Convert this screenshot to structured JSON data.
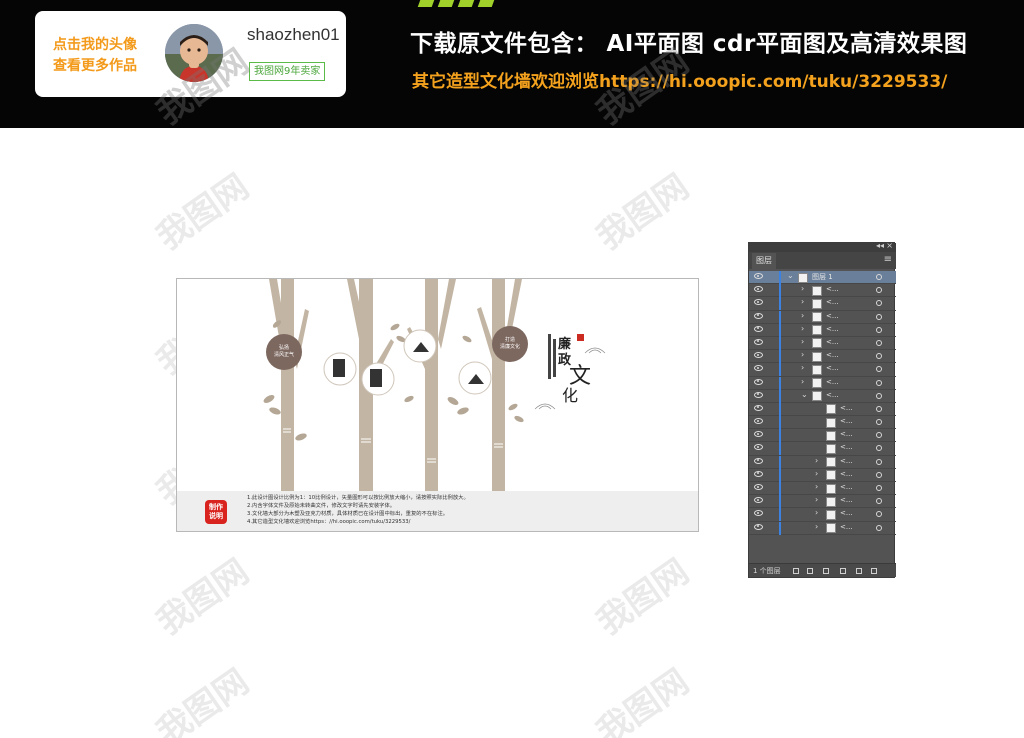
{
  "banner": {
    "profile": {
      "cta_line1": "点击我的头像",
      "cta_line2": "查看更多作品",
      "username": "shaozhen01",
      "badge": "我图网9年卖家"
    },
    "headline": "下载原文件包含：  AI平面图  cdr平面图及高清效果图",
    "subline": "其它造型文化墙欢迎浏览https://hi.ooopic.com/tuku/3229533/"
  },
  "watermark_text": "我图网",
  "artwork": {
    "title_chars": [
      "廉",
      "政",
      "文",
      "化"
    ],
    "circle_left_text": "弘扬\n清风正气",
    "circle_right_text": "打造\n清廉文化",
    "notes_badge": "制作\n说明",
    "notes": [
      "1.此设计图设计比例为1：10比例设计，矢量图形可以按比例放大缩小，请按照实际比例放大。",
      "2.内含字体文件及原始未转曲文件，修改文字时请先安装字体。",
      "3.文化墙大部分为木塑及亚克力材质，具体材质已在设计图中标出，重复的不在标注。",
      "4.其它造型文化墙欢迎浏览https：//hi.ooopic.com/tuku/3229533/"
    ]
  },
  "layers_panel": {
    "tab_label": "图层",
    "top_layer_name": "图层 1",
    "child_name": "<...",
    "footer_count": "1 个图层",
    "close_glyph": "×",
    "collapse_glyph": "◂◂",
    "menu_glyph": "≡",
    "expand_glyph": "›",
    "collapse_row_glyph": "⌄"
  }
}
